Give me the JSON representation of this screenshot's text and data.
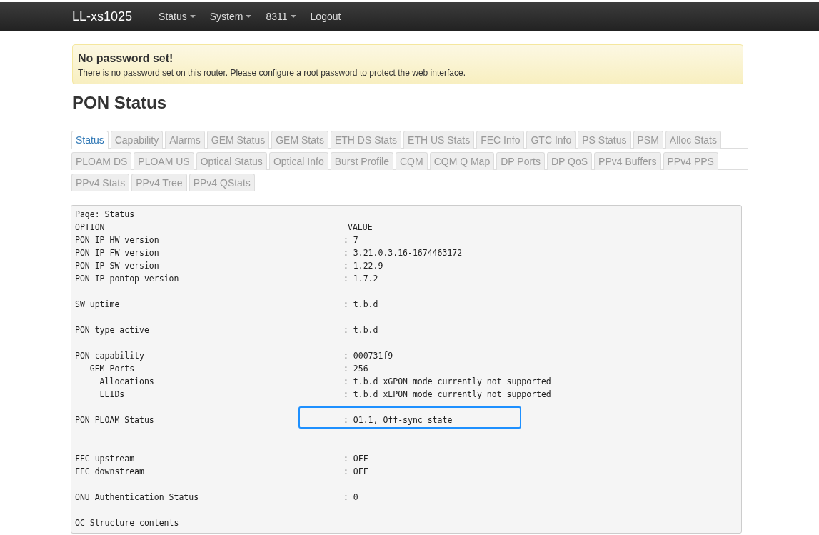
{
  "navbar": {
    "brand": "LL-xs1025",
    "menu": [
      {
        "label": "Status",
        "dropdown": true
      },
      {
        "label": "System",
        "dropdown": true
      },
      {
        "label": "8311",
        "dropdown": true
      },
      {
        "label": "Logout",
        "dropdown": false
      }
    ]
  },
  "alert": {
    "title": "No password set!",
    "message": "There is no password set on this router. Please configure a root password to protect the web interface."
  },
  "heading": "PON Status",
  "tab_rows": [
    [
      {
        "label": "Status",
        "selected": true
      },
      {
        "label": "Capability",
        "selected": false
      },
      {
        "label": "Alarms",
        "selected": false
      },
      {
        "label": "GEM Status",
        "selected": false
      },
      {
        "label": "GEM Stats",
        "selected": false
      },
      {
        "label": "ETH DS Stats",
        "selected": false
      },
      {
        "label": "ETH US Stats",
        "selected": false
      },
      {
        "label": "FEC Info",
        "selected": false
      },
      {
        "label": "GTC Info",
        "selected": false
      },
      {
        "label": "PS Status",
        "selected": false
      },
      {
        "label": "PSM",
        "selected": false
      },
      {
        "label": "Alloc Stats",
        "selected": false
      }
    ],
    [
      {
        "label": "PLOAM DS",
        "selected": false
      },
      {
        "label": "PLOAM US",
        "selected": false
      },
      {
        "label": "Optical Status",
        "selected": false
      },
      {
        "label": "Optical Info",
        "selected": false
      },
      {
        "label": "Burst Profile",
        "selected": false
      },
      {
        "label": "CQM",
        "selected": false
      },
      {
        "label": "CQM Q Map",
        "selected": false
      },
      {
        "label": "DP Ports",
        "selected": false
      },
      {
        "label": "DP QoS",
        "selected": false
      },
      {
        "label": "PPv4 Buffers",
        "selected": false
      },
      {
        "label": "PPv4 PPS",
        "selected": false
      }
    ],
    [
      {
        "label": "PPv4 Stats",
        "selected": false
      },
      {
        "label": "PPv4 Tree",
        "selected": false
      },
      {
        "label": "PPv4 QStats",
        "selected": false
      }
    ]
  ],
  "output": {
    "page_line": "Page: Status",
    "lines": [
      {
        "kind": "header",
        "option": "OPTION",
        "value": "VALUE",
        "highlighted": false
      },
      {
        "kind": "row",
        "option": "PON IP HW version",
        "value": ": 7",
        "highlighted": false
      },
      {
        "kind": "row",
        "option": "PON IP FW version",
        "value": ": 3.21.0.3.16-1674463172",
        "highlighted": false
      },
      {
        "kind": "row",
        "option": "PON IP SW version",
        "value": ": 1.22.9",
        "highlighted": false
      },
      {
        "kind": "row",
        "option": "PON IP pontop version",
        "value": ": 1.7.2",
        "highlighted": false
      },
      {
        "kind": "blank"
      },
      {
        "kind": "row",
        "option": "SW uptime",
        "value": ": t.b.d",
        "highlighted": false
      },
      {
        "kind": "blank"
      },
      {
        "kind": "row",
        "option": "PON type active",
        "value": ": t.b.d",
        "highlighted": false
      },
      {
        "kind": "blank"
      },
      {
        "kind": "row",
        "option": "PON capability",
        "value": ": 000731f9",
        "highlighted": false
      },
      {
        "kind": "row",
        "option": "   GEM Ports",
        "value": ": 256",
        "highlighted": false
      },
      {
        "kind": "row",
        "option": "     Allocations",
        "value": ": t.b.d xGPON mode currently not supported",
        "highlighted": false
      },
      {
        "kind": "row",
        "option": "     LLIDs",
        "value": ": t.b.d xEPON mode currently not supported",
        "highlighted": false
      },
      {
        "kind": "blank"
      },
      {
        "kind": "row",
        "option": "PON PLOAM Status",
        "value": ": O1.1, Off-sync state",
        "highlighted": true
      },
      {
        "kind": "blank"
      },
      {
        "kind": "blank"
      },
      {
        "kind": "row",
        "option": "FEC upstream",
        "value": ": OFF",
        "highlighted": false
      },
      {
        "kind": "row",
        "option": "FEC downstream",
        "value": ": OFF",
        "highlighted": false
      },
      {
        "kind": "blank"
      },
      {
        "kind": "row",
        "option": "ONU Authentication Status",
        "value": ": 0",
        "highlighted": false
      },
      {
        "kind": "blank"
      },
      {
        "kind": "row",
        "option": "OC Structure contents",
        "highlighted": false
      }
    ]
  }
}
